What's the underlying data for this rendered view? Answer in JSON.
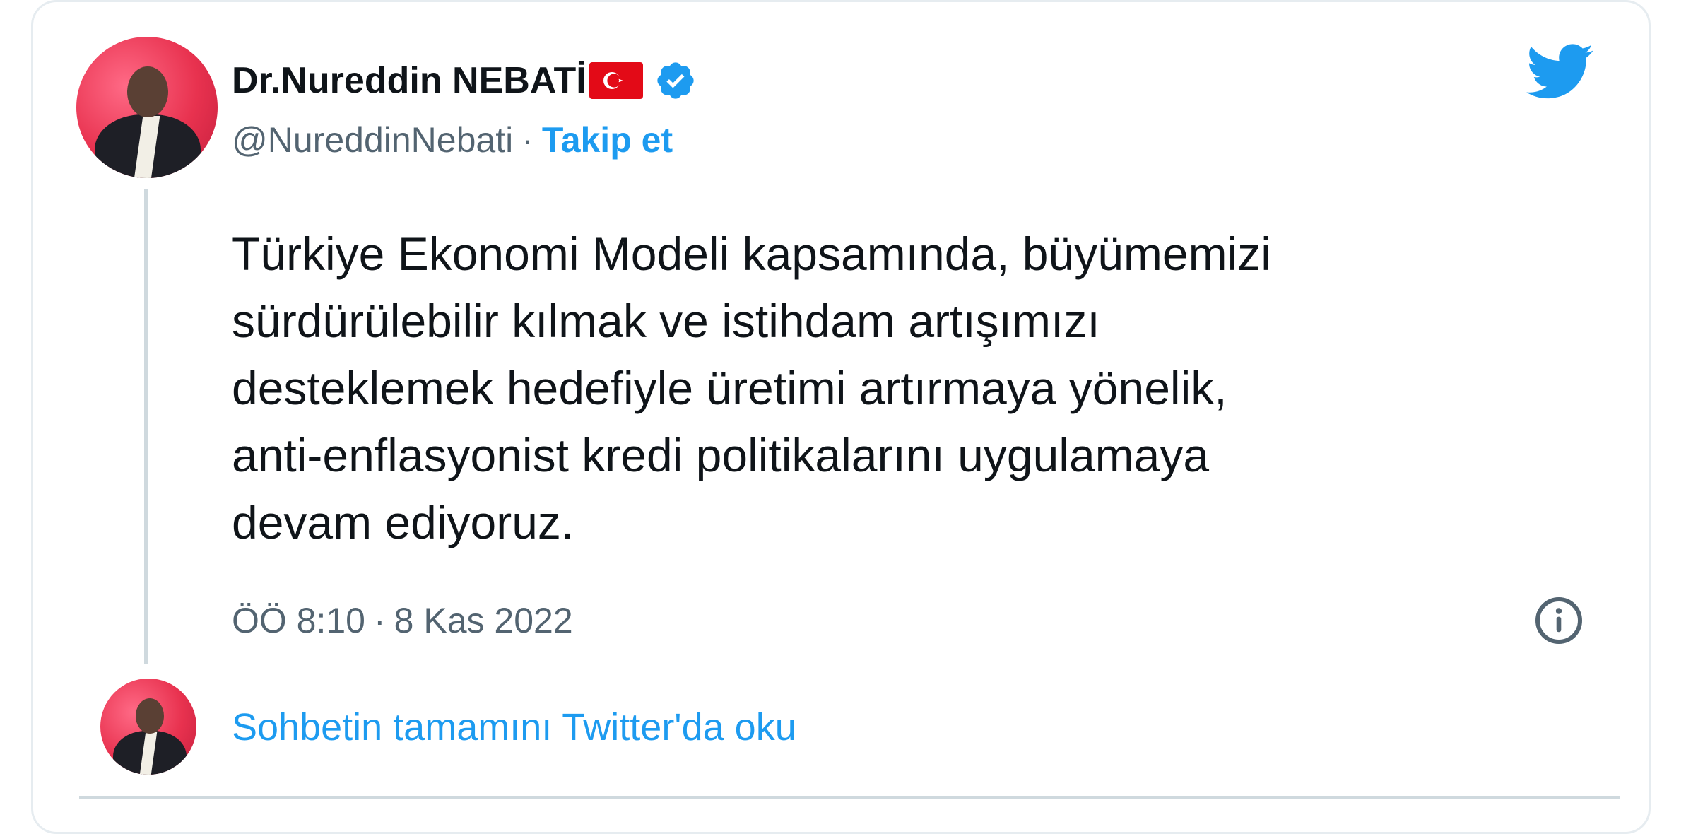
{
  "author": {
    "name": "Dr.Nureddin NEBATİ",
    "handle": "@NureddinNebati",
    "separator": "·",
    "follow_label": "Takip et"
  },
  "tweet": {
    "text": "Türkiye Ekonomi Modeli kapsamında, büyümemizi\nsürdürülebilir kılmak ve istihdam artışımızı\ndesteklemek hedefiyle üretimi artırmaya yönelik,\nanti-enflasyonist kredi politikalarını uygulamaya\ndevam ediyoruz.",
    "time": "ÖÖ 8:10",
    "date": "8 Kas 2022",
    "separator": "·"
  },
  "footer": {
    "read_more": "Sohbetin tamamını Twitter'da oku"
  },
  "icons": {
    "flag": "turkey-flag-icon",
    "verified": "verified-badge-icon",
    "brand": "twitter-logo-icon",
    "info": "info-icon"
  },
  "colors": {
    "accent": "#1d9bf0",
    "text": "#0f1419",
    "secondary": "#536471",
    "flag": "#e30a17"
  }
}
